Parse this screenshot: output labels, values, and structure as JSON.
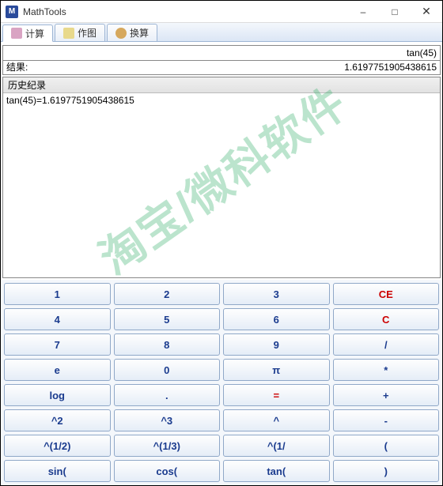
{
  "window": {
    "title": "MathTools",
    "icon_letter": "M"
  },
  "tabs": [
    {
      "label": "计算",
      "icon": "calc-icon",
      "active": true
    },
    {
      "label": "作图",
      "icon": "plot-icon",
      "active": false
    },
    {
      "label": "换算",
      "icon": "convert-icon",
      "active": false
    }
  ],
  "input_expression": "tan(45)",
  "result_label": "结果:",
  "result_value": "1.6197751905438615",
  "history": {
    "header": "历史纪录",
    "entries": [
      "tan(45)=1.6197751905438615"
    ]
  },
  "watermark": "淘宝/微科软件",
  "keypad": [
    [
      {
        "label": "1"
      },
      {
        "label": "2"
      },
      {
        "label": "3"
      },
      {
        "label": "CE",
        "red": true
      }
    ],
    [
      {
        "label": "4"
      },
      {
        "label": "5"
      },
      {
        "label": "6"
      },
      {
        "label": "C",
        "red": true
      }
    ],
    [
      {
        "label": "7"
      },
      {
        "label": "8"
      },
      {
        "label": "9"
      },
      {
        "label": "/"
      }
    ],
    [
      {
        "label": "e"
      },
      {
        "label": "0"
      },
      {
        "label": "π"
      },
      {
        "label": "*"
      }
    ],
    [
      {
        "label": "log"
      },
      {
        "label": "."
      },
      {
        "label": "=",
        "red": true
      },
      {
        "label": "+"
      }
    ],
    [
      {
        "label": "^2"
      },
      {
        "label": "^3"
      },
      {
        "label": "^"
      },
      {
        "label": "-"
      }
    ],
    [
      {
        "label": "^(1/2)"
      },
      {
        "label": "^(1/3)"
      },
      {
        "label": "^(1/"
      },
      {
        "label": "("
      }
    ],
    [
      {
        "label": "sin("
      },
      {
        "label": "cos("
      },
      {
        "label": "tan("
      },
      {
        "label": ")"
      }
    ]
  ]
}
